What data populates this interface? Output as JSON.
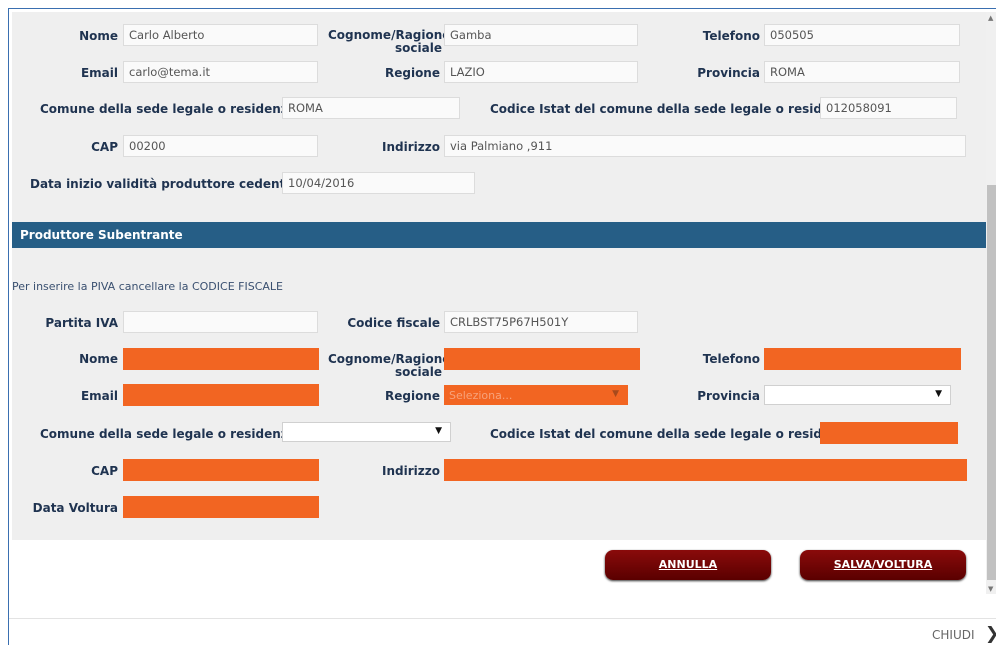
{
  "cedente": {
    "nome": {
      "label": "Nome",
      "value": "Carlo Alberto"
    },
    "cognome": {
      "label": "Cognome/Ragione sociale",
      "value": "Gamba"
    },
    "telefono": {
      "label": "Telefono",
      "value": "050505"
    },
    "email": {
      "label": "Email",
      "value": "carlo@tema.it"
    },
    "regione": {
      "label": "Regione",
      "value": "LAZIO"
    },
    "provincia": {
      "label": "Provincia",
      "value": "ROMA"
    },
    "comune": {
      "label": "Comune della sede legale o residenza",
      "value": "ROMA"
    },
    "istat": {
      "label": "Codice Istat del comune della sede legale o residenza",
      "value": "012058091"
    },
    "cap": {
      "label": "CAP",
      "value": "00200"
    },
    "indirizzo": {
      "label": "Indirizzo",
      "value": "via Palmiano ,911"
    },
    "data_inizio": {
      "label": "Data inizio validità produttore cedente",
      "value": "10/04/2016"
    }
  },
  "subentrante": {
    "title": "Produttore Subentrante",
    "note": "Per inserire la PIVA cancellare la CODICE FISCALE",
    "partita_iva": {
      "label": "Partita IVA",
      "value": ""
    },
    "codice_fiscale": {
      "label": "Codice fiscale",
      "value": "CRLBST75P67H501Y"
    },
    "nome": {
      "label": "Nome",
      "value": ""
    },
    "cognome": {
      "label": "Cognome/Ragione sociale",
      "value": ""
    },
    "telefono": {
      "label": "Telefono",
      "value": ""
    },
    "email": {
      "label": "Email",
      "value": ""
    },
    "regione": {
      "label": "Regione",
      "placeholder": "Seleziona..."
    },
    "provincia": {
      "label": "Provincia",
      "value": ""
    },
    "comune": {
      "label": "Comune della sede legale o residenza",
      "value": ""
    },
    "istat": {
      "label": "Codice Istat del comune della sede legale o residenza",
      "value": ""
    },
    "cap": {
      "label": "CAP",
      "value": ""
    },
    "indirizzo": {
      "label": "Indirizzo",
      "value": ""
    },
    "data_voltura": {
      "label": "Data Voltura",
      "value": ""
    }
  },
  "buttons": {
    "annulla": "ANNULLA",
    "salva": "SALVA/VOLTURA"
  },
  "footer": {
    "chiudi": "CHIUDI",
    "close_glyph": "❯"
  },
  "icons": {
    "dropdown": "▼"
  },
  "colors": {
    "required": "#f26522",
    "header": "#265e86",
    "button": "#6e0505"
  }
}
